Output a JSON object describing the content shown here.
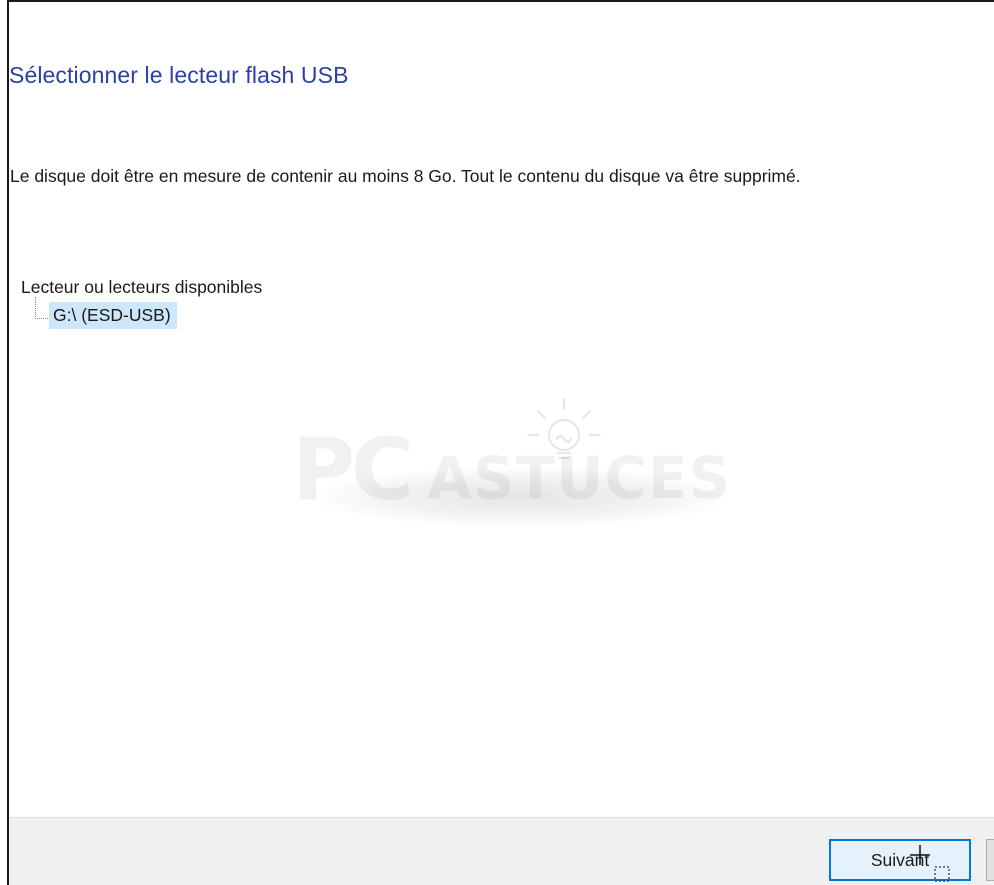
{
  "header": {
    "title": "Sélectionner le lecteur flash USB"
  },
  "main": {
    "description": "Le disque doit être en mesure de contenir au moins 8 Go. Tout le contenu du disque va être supprimé.",
    "drives_tree": {
      "root_label": "Lecteur ou lecteurs disponibles",
      "items": [
        {
          "label": "G:\\ (ESD-USB)",
          "selected": true
        }
      ]
    }
  },
  "watermark": {
    "brand_pc": "PC",
    "brand_astuces": "ASTUCES",
    "icon": "lightbulb-icon"
  },
  "footer": {
    "next_label": "Suivant",
    "cursor_icon": "crosshair-cursor-icon"
  },
  "colors": {
    "title": "#2b3fa8",
    "selection": "#cde6f9",
    "footer_bg": "#f0f0f0",
    "button_border_focus": "#0078d7"
  }
}
